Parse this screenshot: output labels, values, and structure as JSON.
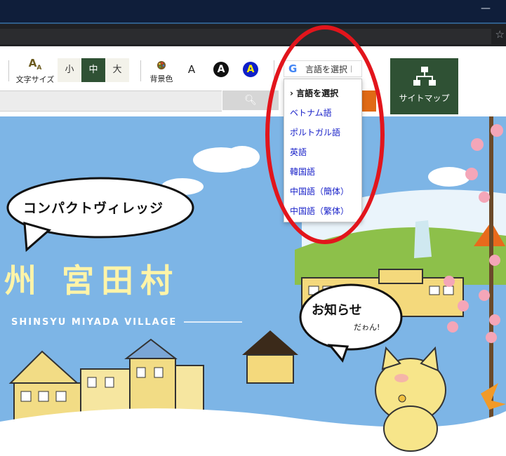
{
  "toolbar": {
    "font_size_label": "文字サイズ",
    "font_size_buttons": [
      "小",
      "中",
      "大"
    ],
    "font_size_selected": "中",
    "background_label": "背景色",
    "background_options": [
      "A",
      "A",
      "A"
    ],
    "translate_label": "言語を選択",
    "sitemap_label": "サイトマップ"
  },
  "language_menu": {
    "items": [
      "› 言語を選択",
      "ベトナム語",
      "ポルトガル語",
      "英語",
      "韓国語",
      "中国語（簡体）",
      "中国語（繁体）"
    ]
  },
  "hero": {
    "speech_bubble": "コンパクトヴィレッジ",
    "title": "州 宮田村",
    "subtitle": "SHINSYU MIYADA VILLAGE",
    "notice": "お知らせ",
    "notice_small": "だゎん!"
  },
  "colors": {
    "accent_green": "#2f5134",
    "hero_sky": "#7db5e6",
    "annotation_red": "#e2151c",
    "link_blue": "#1a22c9"
  },
  "icons": {
    "translate": "google-g-icon",
    "sitemap": "sitemap-tree-icon",
    "search": "search-icon",
    "palette": "palette-icon"
  }
}
